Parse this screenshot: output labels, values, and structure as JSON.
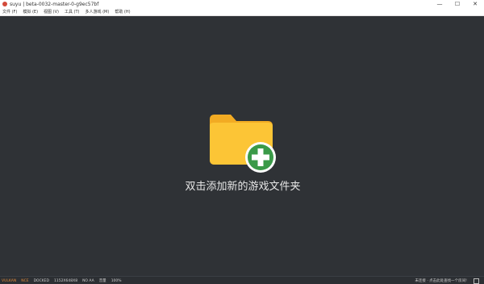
{
  "titlebar": {
    "title": "suyu | beta-0032-master-0-g9ec57bf",
    "minimize": "—",
    "maximize": "☐",
    "close": "✕"
  },
  "menu": [
    {
      "label": "文件 (F)"
    },
    {
      "label": "模拟 (E)"
    },
    {
      "label": "视图 (V)"
    },
    {
      "label": "工具 (T)"
    },
    {
      "label": "多人游戏 (M)"
    },
    {
      "label": "帮助 (H)"
    }
  ],
  "main": {
    "add_label": "双击添加新的游戏文件夹"
  },
  "statusbar": {
    "items": [
      {
        "label": "VULKAN",
        "accent": true
      },
      {
        "label": "NCE",
        "accent": true
      },
      {
        "label": "DOCKED",
        "accent": false
      },
      {
        "label": "1152X648X8",
        "accent": false
      },
      {
        "label": "NO AA",
        "accent": false
      },
      {
        "label": "音量",
        "accent": false
      },
      {
        "label": "100%",
        "accent": false
      }
    ],
    "right_text": "未连接 · 点击此处查找一个房间!"
  },
  "colors": {
    "folder": "#fcc536",
    "folder_tab": "#f2ab23",
    "plus_badge": "#3a9a48"
  }
}
